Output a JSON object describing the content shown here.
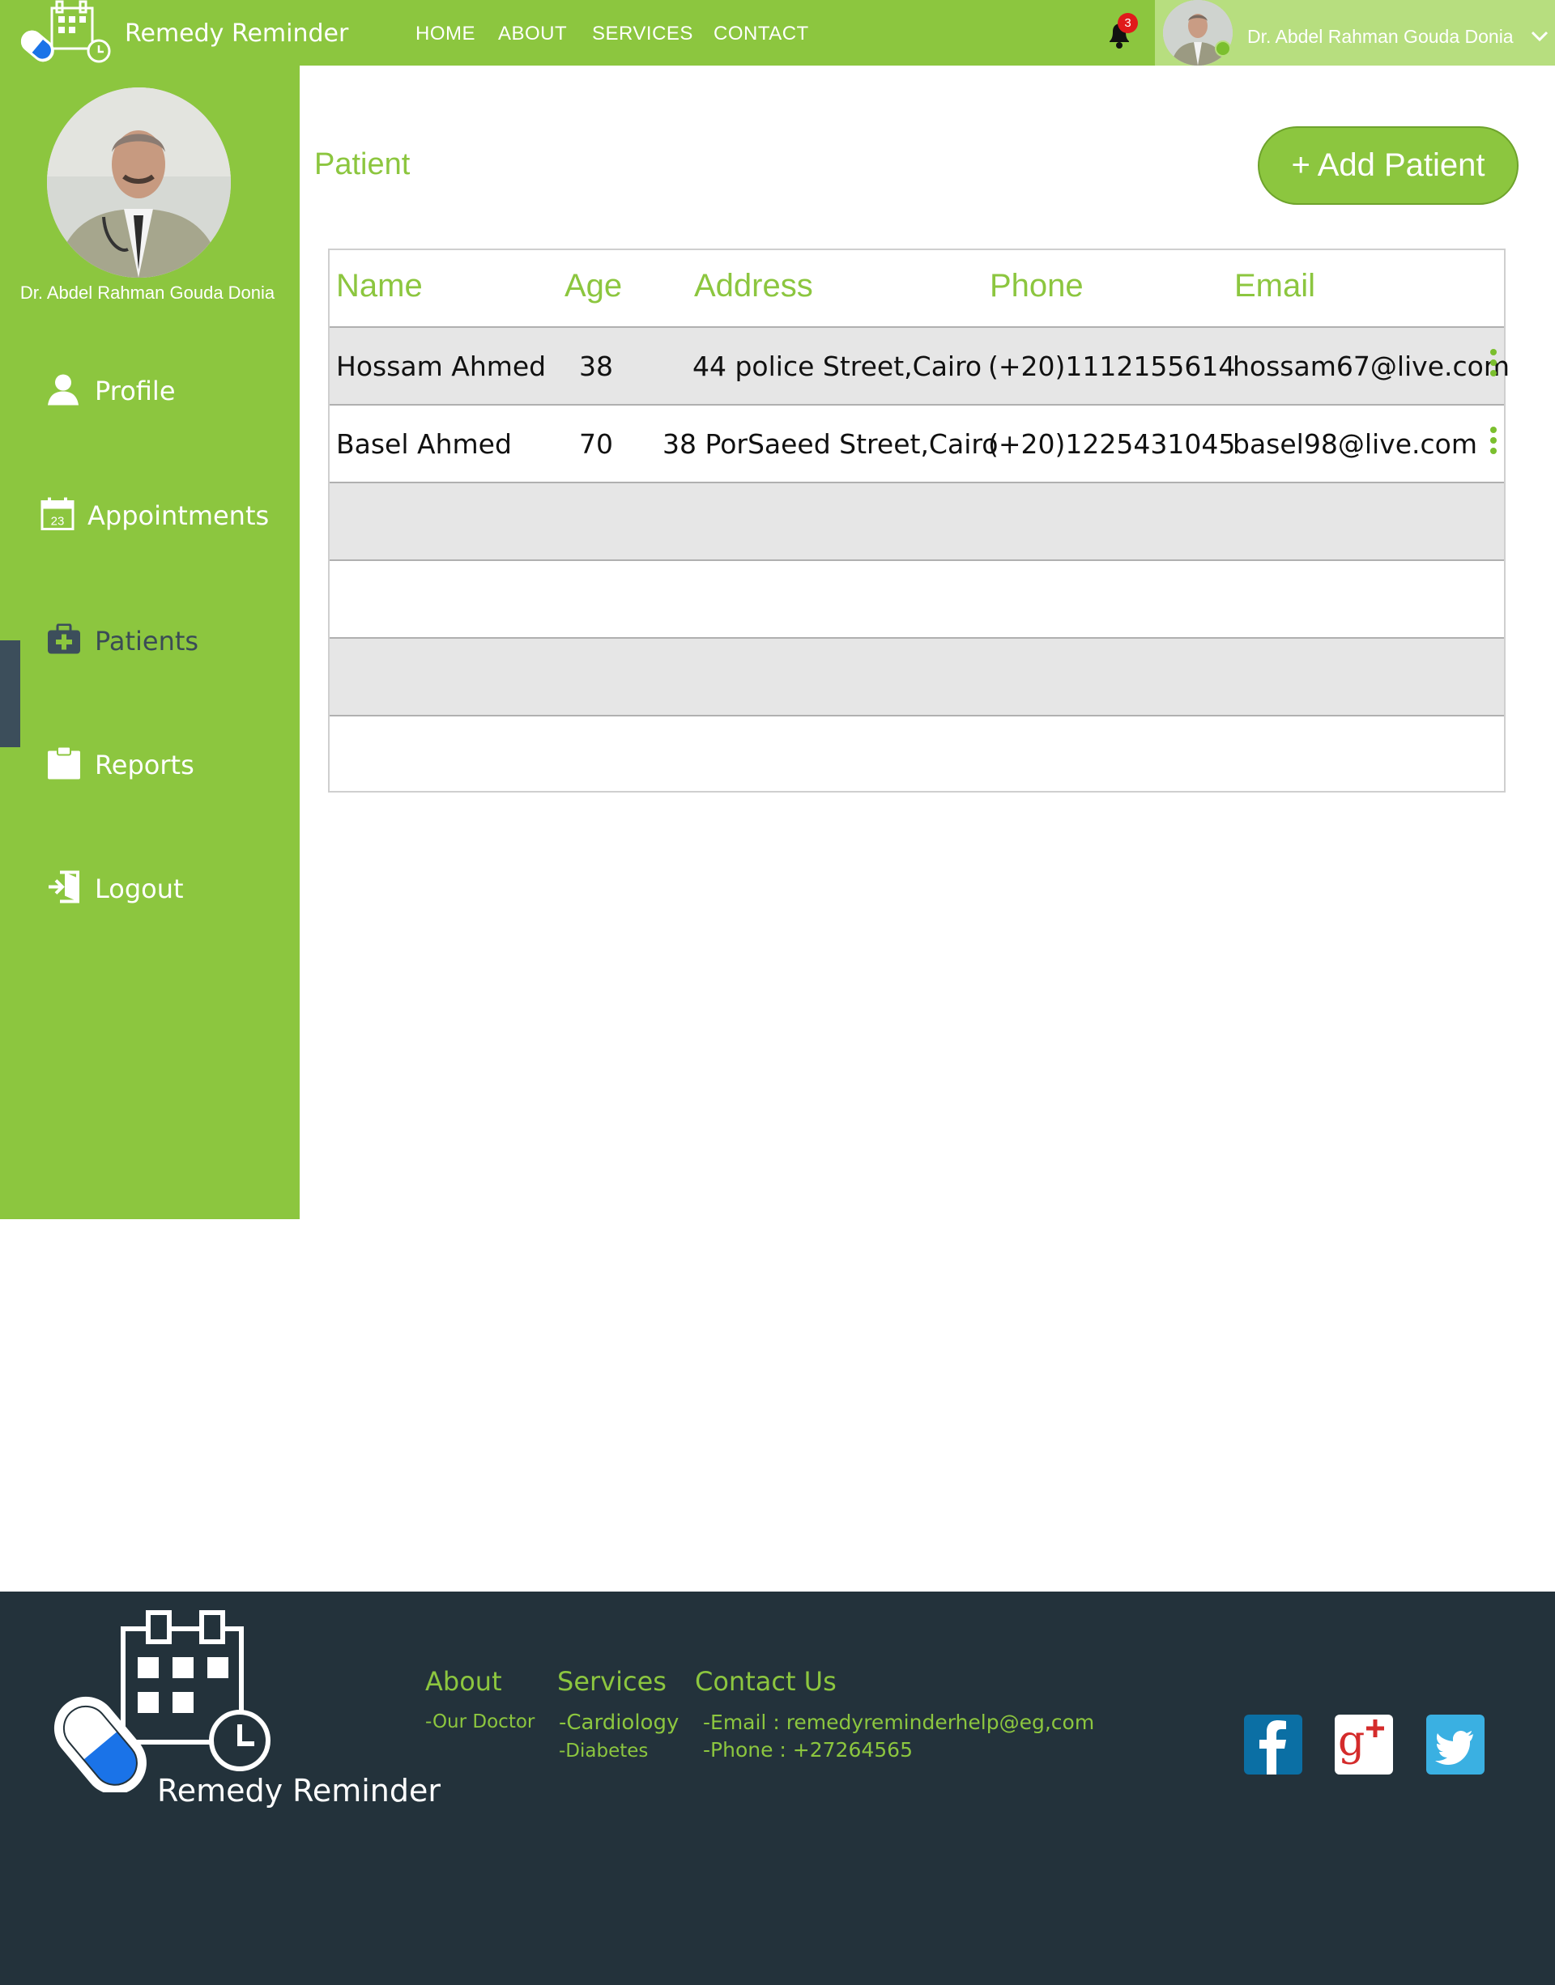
{
  "header": {
    "brand": "Remedy Reminder",
    "nav": [
      "HOME",
      "ABOUT",
      "SERVICES",
      "CONTACT"
    ],
    "notifications_count": "3",
    "user_name": "Dr. Abdel Rahman Gouda Donia"
  },
  "sidebar": {
    "doctor_name": "Dr. Abdel Rahman Gouda Donia",
    "items": [
      {
        "label": "Profile",
        "icon": "user-icon"
      },
      {
        "label": "Appointments",
        "icon": "calendar-icon"
      },
      {
        "label": "Patients",
        "icon": "medical-kit-icon",
        "active": true
      },
      {
        "label": "Reports",
        "icon": "clipboard-icon"
      },
      {
        "label": "Logout",
        "icon": "logout-icon"
      }
    ]
  },
  "main": {
    "title": "Patient",
    "add_button": "+ Add Patient",
    "table": {
      "columns": [
        "Name",
        "Age",
        "Address",
        "Phone",
        "Email"
      ],
      "rows": [
        [
          "Hossam Ahmed",
          "38",
          "44 police Street,Cairo",
          "(+20)1112155614",
          "hossam67@live.com"
        ],
        [
          "Basel Ahmed",
          "70",
          "38 PorSaeed Street,Cairo",
          "(+20)1225431045",
          "basel98@live.com"
        ]
      ]
    }
  },
  "footer": {
    "brand": "Remedy Reminder",
    "about": {
      "title": "About",
      "links": [
        "-Our Doctor"
      ]
    },
    "services": {
      "title": "Services",
      "links": [
        "-Cardiology",
        "-Diabetes"
      ]
    },
    "contact": {
      "title": "Contact Us",
      "lines": [
        "-Email : remedyreminderhelp@eg,com",
        "-Phone : +27264565"
      ]
    },
    "social": [
      "facebook-icon",
      "google-plus-icon",
      "twitter-icon"
    ]
  },
  "colors": {
    "primary_green": "#8cc63f",
    "light_green": "#b7de7f",
    "footer_dark": "#23323b",
    "active_indicator": "#3c4e5b",
    "badge_red": "#e01b1b"
  }
}
